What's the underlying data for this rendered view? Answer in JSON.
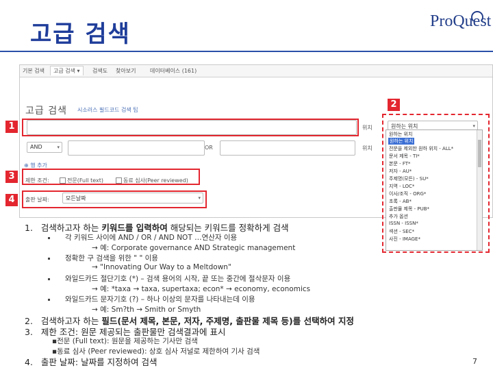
{
  "slide": {
    "title": "고급 검색",
    "logo": "ProQuest",
    "page_number": "7"
  },
  "tabs": [
    "기본 검색",
    "고급 검색 ▾",
    "검색도",
    "찾아보기",
    "데이터베이스 (161)"
  ],
  "panel": {
    "heading": "고급 검색",
    "heading_links": "시소러스  필드코드  검색 팁",
    "field_label": "위치",
    "field_label2": "위치",
    "bool_op": "AND",
    "or_op": "OR",
    "add_row": "⊕ 행 추가",
    "limit_label": "제한 조건:",
    "fulltext_label": "전문(Full text)",
    "peer_label": "동료 심사(Peer reviewed)",
    "pubdate_label": "출판 날짜:",
    "pubdate_value": "모든날짜",
    "field_select": "원하는 위치"
  },
  "callouts": [
    "1",
    "2",
    "3",
    "4"
  ],
  "dropdown": {
    "options": [
      "원하는 위치",
      "원하는 위치",
      "전문을 제외한 원하  위치 - ALL*",
      "문서 제목 - TI*",
      "본문 - FT*",
      "저자 - AU*",
      "주제명(모든) - SU*",
      "    지역 - LOC*",
      "    이사/조직 - ORG*",
      "초록 - AB*",
      "출판물 제목 - PUB*",
      "추가 옵션",
      "    ISSN - ISSN*",
      "    섹션 - SEC*",
      "    사진 - IMAGE*"
    ],
    "selected_index": 1
  },
  "bullets": {
    "item1_num": "1.",
    "item1_pre": "검색하고자 하는 ",
    "item1_bold": "키워드를 입력하여",
    "item1_post": " 해당되는 키워드를 정확하게 검색",
    "b1": "각 키워드 사이에 AND / OR / AND NOT …연산자 이용",
    "b1_ex": "→ 예: Corporate governance AND Strategic management",
    "b2": "정확한 구 검색을 위한 \"    \" 이용",
    "b2_ex": "→ \"Innovating Our Way to a Meltdown\"",
    "b3": "와일드카드 절단기호 (*) – 검색 용어의 시작, 끝 또는 중간에 절삭문자 이용",
    "b3_ex": "→ 예: *taxa → taxa, supertaxa; econ* → economy, economics",
    "b4": "와일드카드 문자기호 (?) – 하나 이상의 문자를 나타내는데 이용",
    "b4_ex": "→ 예: Sm?th → Smith or Smyth",
    "item2_num": "2.",
    "item2_pre": "검색하고자 하는 ",
    "item2_bold": "필드(문서 제목, 본문, 저자, 주제명, 출판물 제목 등)를 선택하여 지정",
    "item3_num": "3.",
    "item3_text": "제한 조건: 원문 제공되는 출판물만 검색결과에 표시",
    "item3a": "▪전문 (Full text): 원문을 제공하는 기사만 검색",
    "item3b": "▪동료 심사 (Peer reviewed): 상호 심사 저널로 제한하여 기사 검색",
    "item4_num": "4.",
    "item4_text": "출판 날짜: 날짜를 지정하여 검색"
  },
  "colors": {
    "title": "#1f3d9a",
    "callout": "#e3262f",
    "selected": "#3b6fd4"
  }
}
